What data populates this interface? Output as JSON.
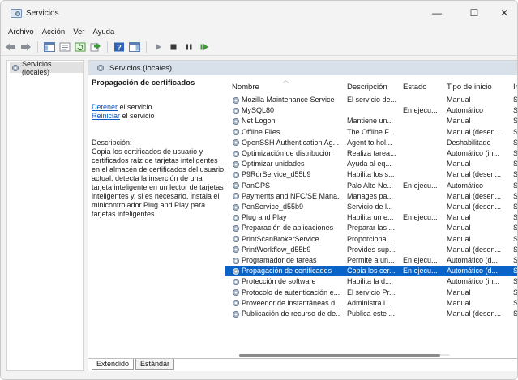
{
  "window": {
    "title": "Servicios",
    "minimize": "—",
    "maximize": "☐",
    "close": "✕"
  },
  "menu": [
    "Archivo",
    "Acción",
    "Ver",
    "Ayuda"
  ],
  "tree": {
    "root_label": "Servicios (locales)"
  },
  "header": {
    "title": "Servicios (locales)"
  },
  "detail": {
    "title": "Propagación de certificados",
    "stop_link": "Detener",
    "stop_rest": " el servicio",
    "restart_link": "Reiniciar",
    "restart_rest": " el servicio",
    "description_label": "Descripción:",
    "description": "Copia los certificados de usuario y certificados raíz de tarjetas inteligentes en el almacén de certificados del usuario actual, detecta la inserción de una tarjeta inteligente en un lector de tarjetas inteligentes y, si es necesario, instala el minicontrolador Plug and Play para tarjetas inteligentes."
  },
  "columns": {
    "name": "Nombre",
    "description": "Descripción",
    "status": "Estado",
    "startup": "Tipo de inicio",
    "extra": "Ir"
  },
  "services": [
    {
      "name": "Mozilla Maintenance Service",
      "desc": "El servicio de...",
      "status": "",
      "start": "Manual",
      "extra": "Si"
    },
    {
      "name": "MySQL80",
      "desc": "",
      "status": "En ejecu...",
      "start": "Automático",
      "extra": "Si"
    },
    {
      "name": "Net Logon",
      "desc": "Mantiene un...",
      "status": "",
      "start": "Manual",
      "extra": "Si"
    },
    {
      "name": "Offline Files",
      "desc": "The Offline F...",
      "status": "",
      "start": "Manual (desen...",
      "extra": "Si"
    },
    {
      "name": "OpenSSH Authentication Ag...",
      "desc": "Agent to hol...",
      "status": "",
      "start": "Deshabilitado",
      "extra": "Si"
    },
    {
      "name": "Optimización de distribución",
      "desc": "Realiza tarea...",
      "status": "",
      "start": "Automático (in...",
      "extra": "Se"
    },
    {
      "name": "Optimizar unidades",
      "desc": "Ayuda al eq...",
      "status": "",
      "start": "Manual",
      "extra": "Si"
    },
    {
      "name": "P9RdrService_d55b9",
      "desc": "Habilita los s...",
      "status": "",
      "start": "Manual (desen...",
      "extra": "Si"
    },
    {
      "name": "PanGPS",
      "desc": "Palo Alto Ne...",
      "status": "En ejecu...",
      "start": "Automático",
      "extra": "Si"
    },
    {
      "name": "Payments and NFC/SE Mana...",
      "desc": "Manages pa...",
      "status": "",
      "start": "Manual (desen...",
      "extra": "Se"
    },
    {
      "name": "PenService_d55b9",
      "desc": "Servicio de l...",
      "status": "",
      "start": "Manual (desen...",
      "extra": "Si"
    },
    {
      "name": "Plug and Play",
      "desc": "Habilita un e...",
      "status": "En ejecu...",
      "start": "Manual",
      "extra": "Si"
    },
    {
      "name": "Preparación de aplicaciones",
      "desc": "Preparar las ...",
      "status": "",
      "start": "Manual",
      "extra": "Si"
    },
    {
      "name": "PrintScanBrokerService",
      "desc": "Proporciona ...",
      "status": "",
      "start": "Manual",
      "extra": "Si"
    },
    {
      "name": "PrintWorkflow_d55b9",
      "desc": "Provides sup...",
      "status": "",
      "start": "Manual (desen...",
      "extra": "Si"
    },
    {
      "name": "Programador de tareas",
      "desc": "Permite a un...",
      "status": "En ejecu...",
      "start": "Automático (d...",
      "extra": "Si"
    },
    {
      "name": "Propagación de certificados",
      "desc": "Copia los cer...",
      "status": "En ejecu...",
      "start": "Automático (d...",
      "extra": "Si",
      "selected": true
    },
    {
      "name": "Protección de software",
      "desc": "Habilita la d...",
      "status": "",
      "start": "Automático (in...",
      "extra": "Se"
    },
    {
      "name": "Protocolo de autenticación e...",
      "desc": "El servicio Pr...",
      "status": "",
      "start": "Manual",
      "extra": "Si"
    },
    {
      "name": "Proveedor de instantáneas d...",
      "desc": "Administra i...",
      "status": "",
      "start": "Manual",
      "extra": "Si"
    },
    {
      "name": "Publicación de recurso de de...",
      "desc": "Publica este ...",
      "status": "",
      "start": "Manual (desen...",
      "extra": "Se"
    }
  ],
  "tabs": [
    "Extendido",
    "Estándar"
  ],
  "colors": {
    "selection": "#0a64c8",
    "link": "#0b57c5",
    "header_bg": "#d8e0ea"
  }
}
